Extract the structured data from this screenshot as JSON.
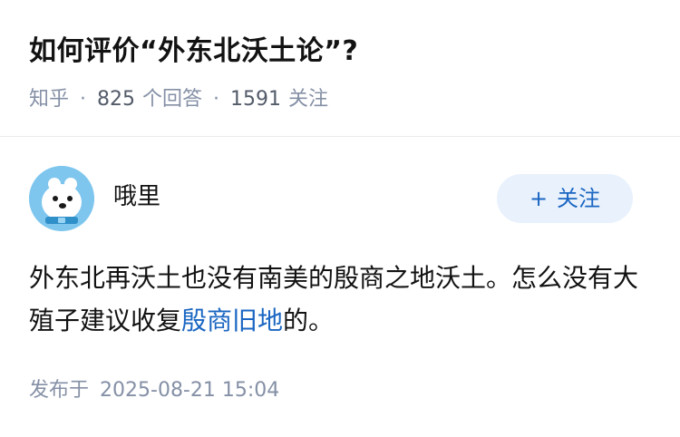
{
  "question": {
    "title": "如何评价“外东北沃土论”?",
    "source": "知乎",
    "answers_count": "825",
    "answers_label": "个回答",
    "follow_count": "1591",
    "follow_label": "关注"
  },
  "author": {
    "name": "哦里",
    "avatar_icon": "polar-bear-avatar",
    "follow_button": {
      "icon": "plus-icon",
      "plus": "+",
      "label": "关注"
    }
  },
  "answer": {
    "text_before": "外东北再沃土也没有南美的殷商之地沃土。怎么没有大殖子建议收复",
    "link_text": "殷商旧地",
    "text_after": "的。"
  },
  "meta": {
    "published_label": "发布于",
    "published_time": "2025-08-21 15:04"
  },
  "colors": {
    "link": "#1a66c2",
    "meta_gray": "#8590a6",
    "follow_bg": "#e8f1fc"
  }
}
